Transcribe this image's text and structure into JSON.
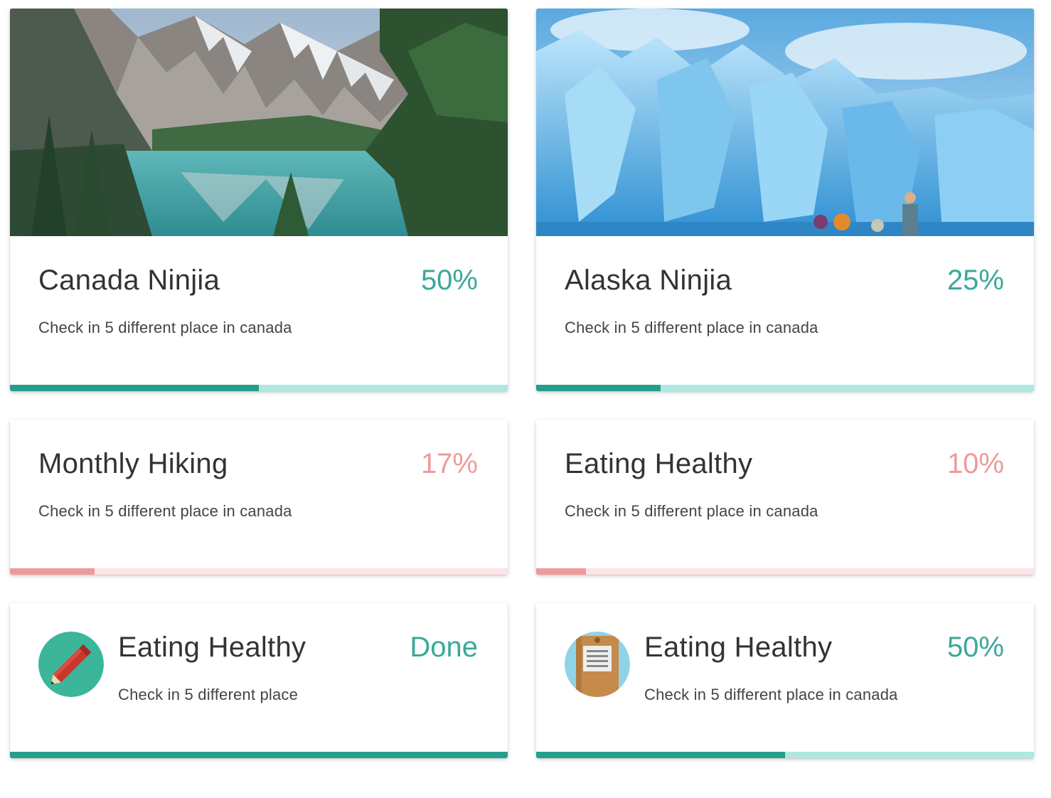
{
  "colors": {
    "teal": "#3aa89a",
    "teal_dark": "#269e8c",
    "teal_light": "#aee8e0",
    "pink": "#ef9a9a",
    "pink_light": "#fde4e6"
  },
  "cards": [
    {
      "title": "Canada Ninjia",
      "value": "50%",
      "description": "Check in 5 different place in canada",
      "progress": 0.5,
      "accent": "teal",
      "image": "mountain-lake-photo"
    },
    {
      "title": "Alaska Ninjia",
      "value": "25%",
      "description": "Check in 5 different place in canada",
      "progress": 0.25,
      "accent": "teal",
      "image": "glacier-photo"
    },
    {
      "title": "Monthly Hiking",
      "value": "17%",
      "description": "Check in 5 different place in canada",
      "progress": 0.17,
      "accent": "pink"
    },
    {
      "title": "Eating Healthy",
      "value": "10%",
      "description": "Check in 5 different place in canada",
      "progress": 0.1,
      "accent": "pink"
    },
    {
      "title": "Eating Healthy",
      "value": "Done",
      "description": "Check in 5 different place",
      "progress": 1.0,
      "accent": "teal",
      "icon": "pencil-icon"
    },
    {
      "title": "Eating Healthy",
      "value": "50%",
      "description": "Check in 5 different place in canada",
      "progress": 0.5,
      "accent": "teal",
      "icon": "clipboard-icon"
    }
  ]
}
